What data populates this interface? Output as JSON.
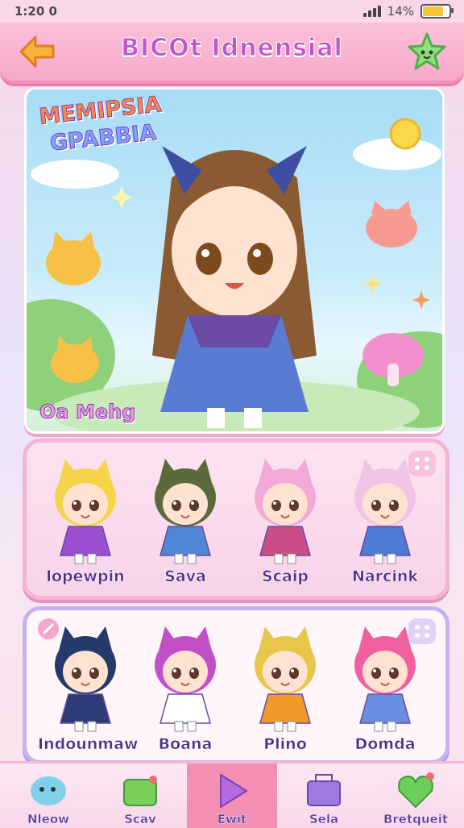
{
  "status": {
    "time": "1:20 0",
    "battery": "14%",
    "battery_level": 0.9
  },
  "header": {
    "title": "BICOt Idnensial"
  },
  "hero": {
    "title_line1": "MEMIPSIA",
    "title_line2": "GPABBIA",
    "caption": "Oa Mehg"
  },
  "row1": {
    "characters": [
      {
        "name": "lopewpin",
        "hair": "#f5d44a",
        "outfit": "#9c4fd0"
      },
      {
        "name": "Sava",
        "hair": "#5a6a3a",
        "outfit": "#4f86d6"
      },
      {
        "name": "Scaip",
        "hair": "#f3a9d8",
        "outfit": "#c94f86"
      },
      {
        "name": "Narcink",
        "hair": "#f1c4e6",
        "outfit": "#4f7ad6"
      }
    ]
  },
  "row2": {
    "characters": [
      {
        "name": "Indounmaw",
        "hair": "#233a6b",
        "outfit": "#2d3c78"
      },
      {
        "name": "Boana",
        "hair": "#c34fc8",
        "outfit": "#ffffff"
      },
      {
        "name": "Plino",
        "hair": "#e8c64a",
        "outfit": "#f09a2a"
      },
      {
        "name": "Domda",
        "hair": "#f0609e",
        "outfit": "#6a8ee0"
      }
    ]
  },
  "nav": {
    "items": [
      {
        "label": "Nleow",
        "icon": "blob-icon",
        "color": "#7fd0e8"
      },
      {
        "label": "Scav",
        "icon": "folder-icon",
        "color": "#7ccf5a"
      },
      {
        "label": "Ewit",
        "icon": "play-icon",
        "color": "#b46be0"
      },
      {
        "label": "Sela",
        "icon": "box-icon",
        "color": "#9e7be0"
      },
      {
        "label": "Bretqueit",
        "icon": "heart-icon",
        "color": "#6ccf5a"
      }
    ]
  }
}
